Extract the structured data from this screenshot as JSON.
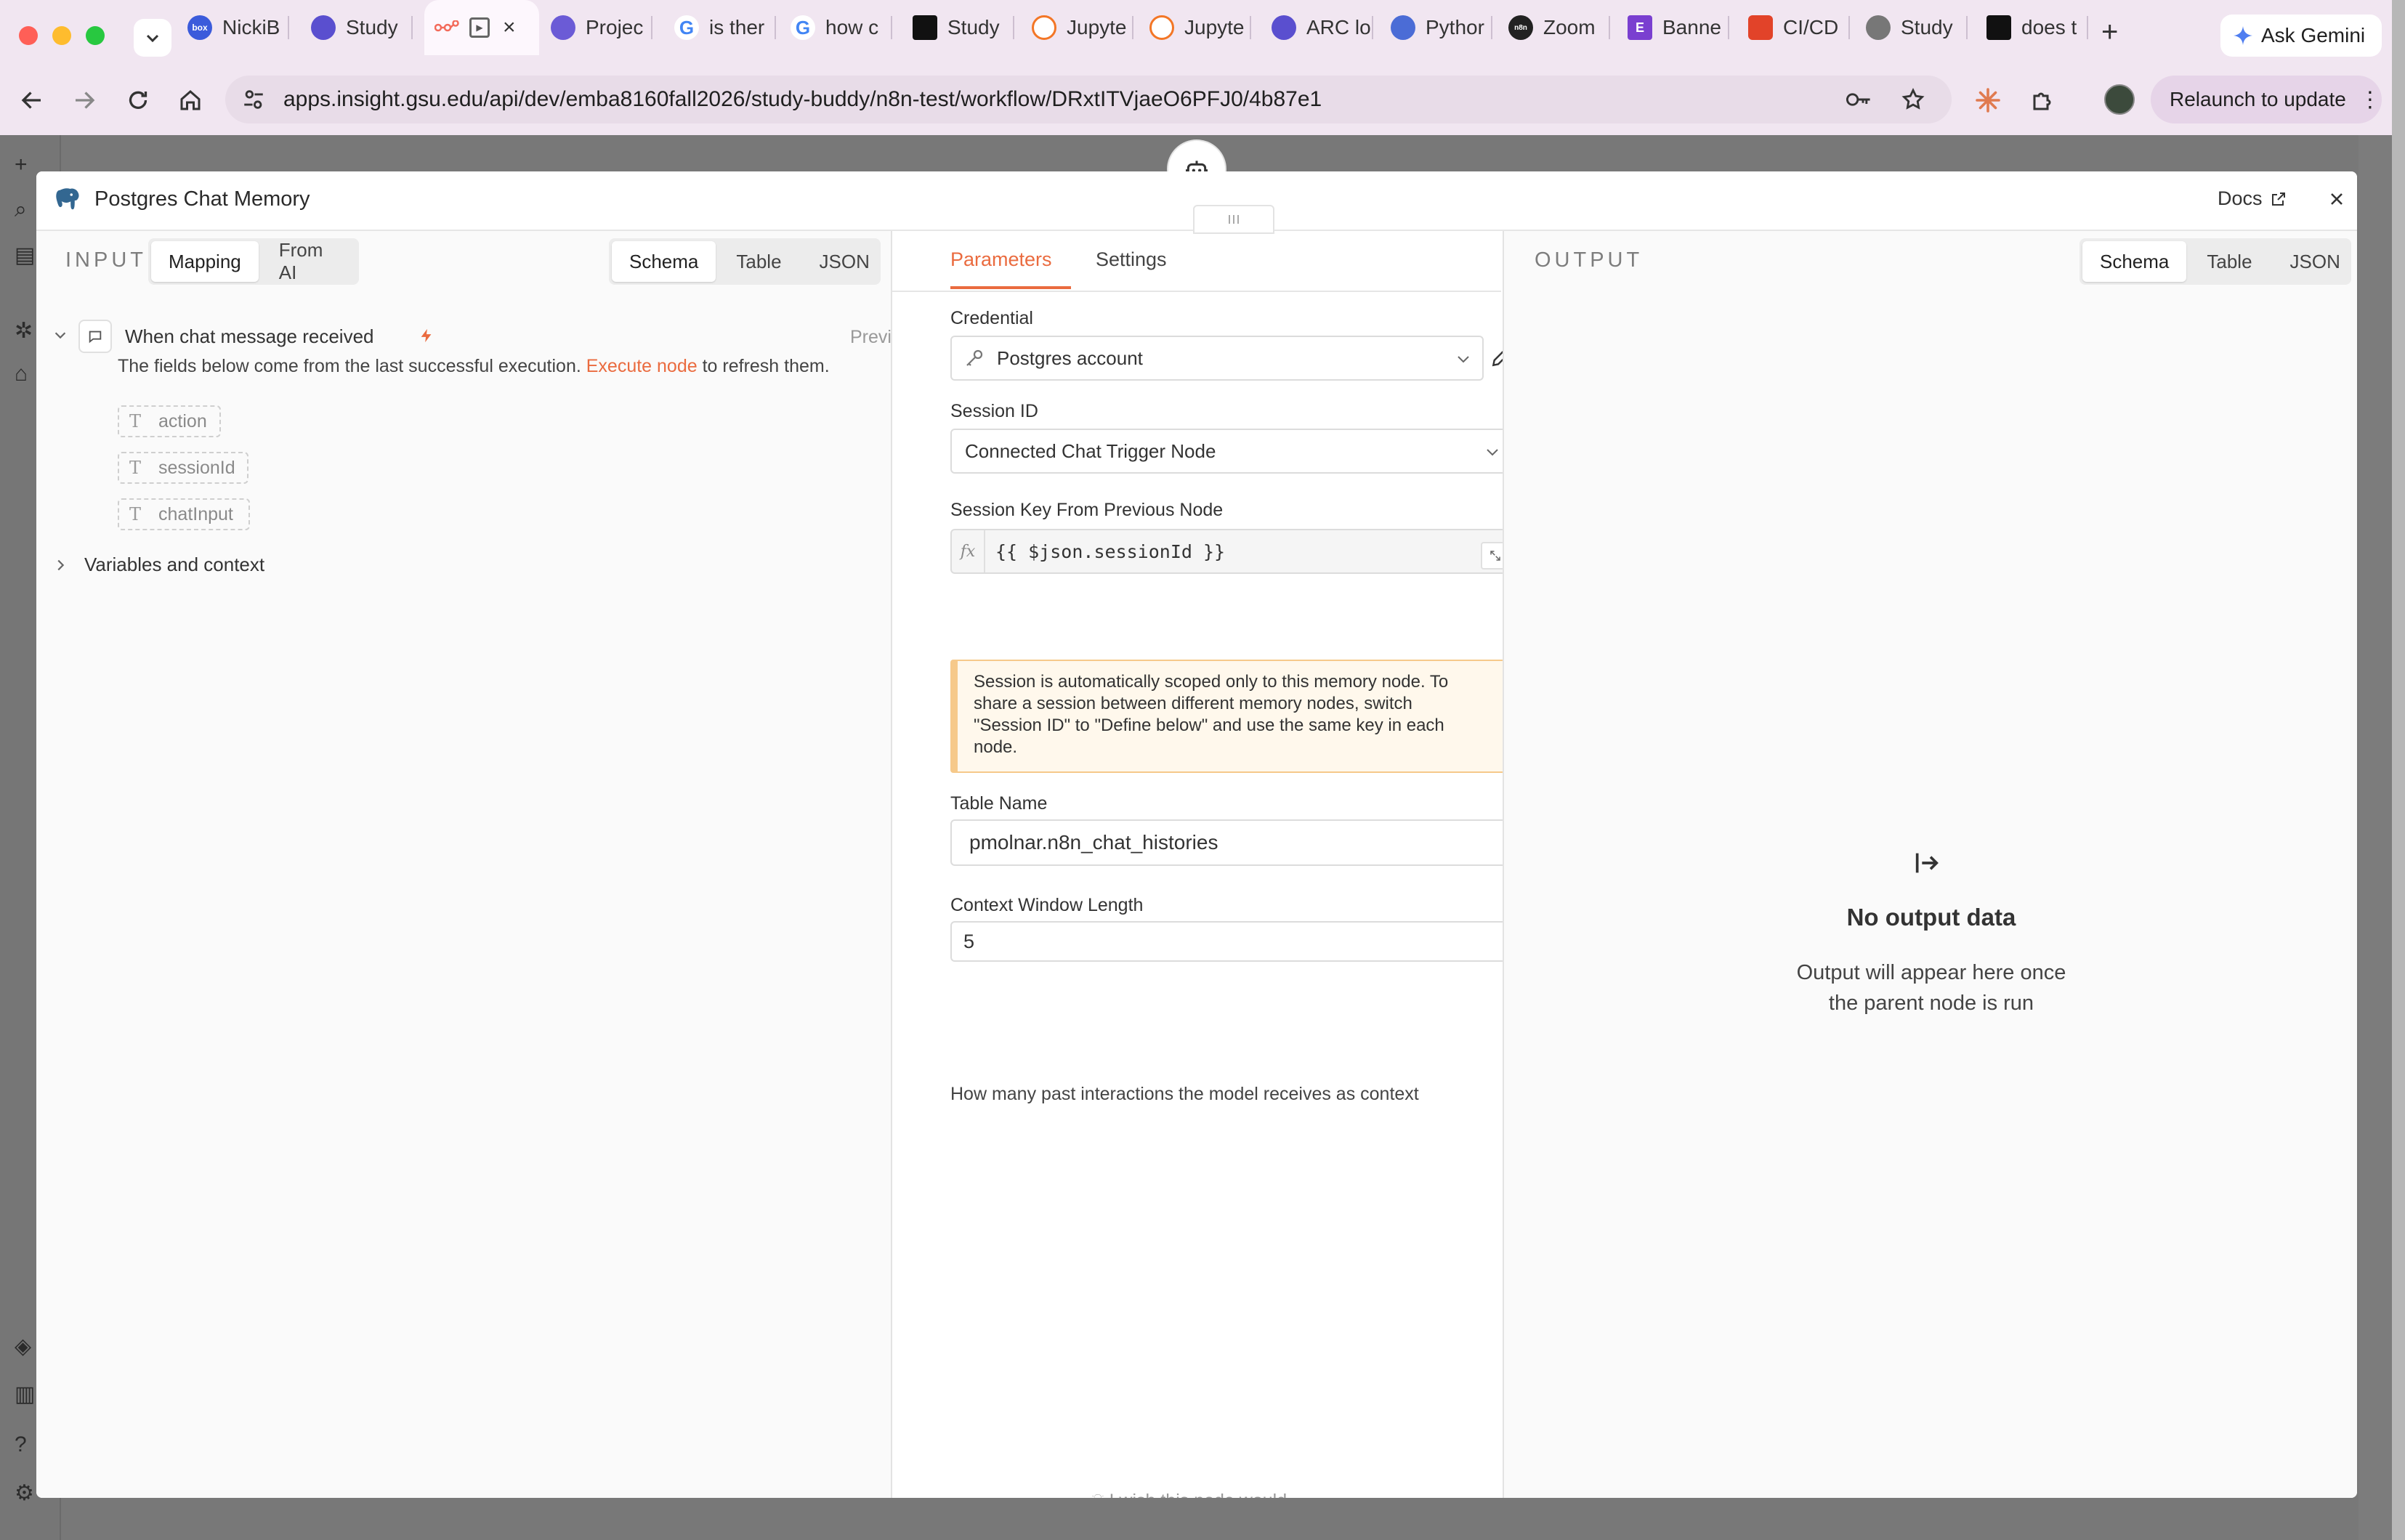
{
  "browser": {
    "tabs": [
      {
        "label": "NickiB",
        "fav_color": "#3b5bdb",
        "fav_text": "box"
      },
      {
        "label": "Study",
        "fav_color": "#5a4fcf",
        "fav_text": ""
      },
      {
        "label": "",
        "fav_color": "#f36b5b",
        "fav_text": ""
      },
      {
        "label": "Projec",
        "fav_color": "#6b5bd6",
        "fav_text": ""
      },
      {
        "label": "is ther",
        "fav_color": "#4285f4",
        "fav_text": "G"
      },
      {
        "label": "how c",
        "fav_color": "#4285f4",
        "fav_text": "G"
      },
      {
        "label": "Study",
        "fav_color": "#111111",
        "fav_text": ""
      },
      {
        "label": "Jupyte",
        "fav_color": "#f37626",
        "fav_text": ""
      },
      {
        "label": "Jupyte",
        "fav_color": "#f37626",
        "fav_text": ""
      },
      {
        "label": "ARC lo",
        "fav_color": "#5a4fcf",
        "fav_text": ""
      },
      {
        "label": "Pythor",
        "fav_color": "#4b6cd6",
        "fav_text": ""
      },
      {
        "label": "Zoom",
        "fav_color": "#222222",
        "fav_text": "n8n"
      },
      {
        "label": "Banne",
        "fav_color": "#7a3fd0",
        "fav_text": "E"
      },
      {
        "label": "CI/CD",
        "fav_color": "#e24329",
        "fav_text": ""
      },
      {
        "label": "Study",
        "fav_color": "#666666",
        "fav_text": ""
      },
      {
        "label": "does t",
        "fav_color": "#111111",
        "fav_text": ""
      }
    ],
    "new_tab": "+",
    "ask_gemini": "Ask Gemini",
    "url": "apps.insight.gsu.edu/api/dev/emba8160fall2026/study-buddy/n8n-test/workflow/DRxtITVjaeO6PFJ0/4b87e1",
    "relaunch": "Relaunch to update"
  },
  "modal": {
    "title": "Postgres Chat Memory",
    "docs": "Docs",
    "input": {
      "label": "INPUT",
      "mode_tabs": [
        "Mapping",
        "From AI"
      ],
      "view_tabs": [
        "Schema",
        "Table",
        "JSON"
      ],
      "node_name": "When chat message received",
      "preview": "Preview",
      "info_prefix": "The fields below come from the last successful execution.",
      "info_link": "Execute node",
      "info_suffix": "to refresh them.",
      "fields": [
        "action",
        "sessionId",
        "chatInput"
      ],
      "field_type": "T",
      "variables": "Variables and context"
    },
    "params": {
      "tabs": [
        "Parameters",
        "Settings"
      ],
      "credential_label": "Credential",
      "credential_value": "Postgres account",
      "session_id_label": "Session ID",
      "session_id_value": "Connected Chat Trigger Node",
      "session_key_label": "Session Key From Previous Node",
      "fx": "fx",
      "session_key_expr": "{{ $json.sessionId }}",
      "notice_lines": [
        "Session is automatically scoped only to this memory node. To",
        "share a session between different memory nodes, switch",
        "\"Session ID\" to \"Define below\" and use the same key in each",
        "node."
      ],
      "table_name_label": "Table Name",
      "table_name_value": "pmolnar.n8n_chat_histories",
      "context_label": "Context Window Length",
      "context_value": "5",
      "context_hint": "How many past interactions the model receives as context",
      "wish": "I wish this node would..."
    },
    "output": {
      "label": "OUTPUT",
      "view_tabs": [
        "Schema",
        "Table",
        "JSON"
      ],
      "empty_title": "No output data",
      "empty_desc": "Output will appear here once the parent node is run"
    }
  },
  "colors": {
    "accent": "#ea6b3f",
    "notice_bg": "#fff8ec",
    "notice_border": "#f6c98a"
  }
}
